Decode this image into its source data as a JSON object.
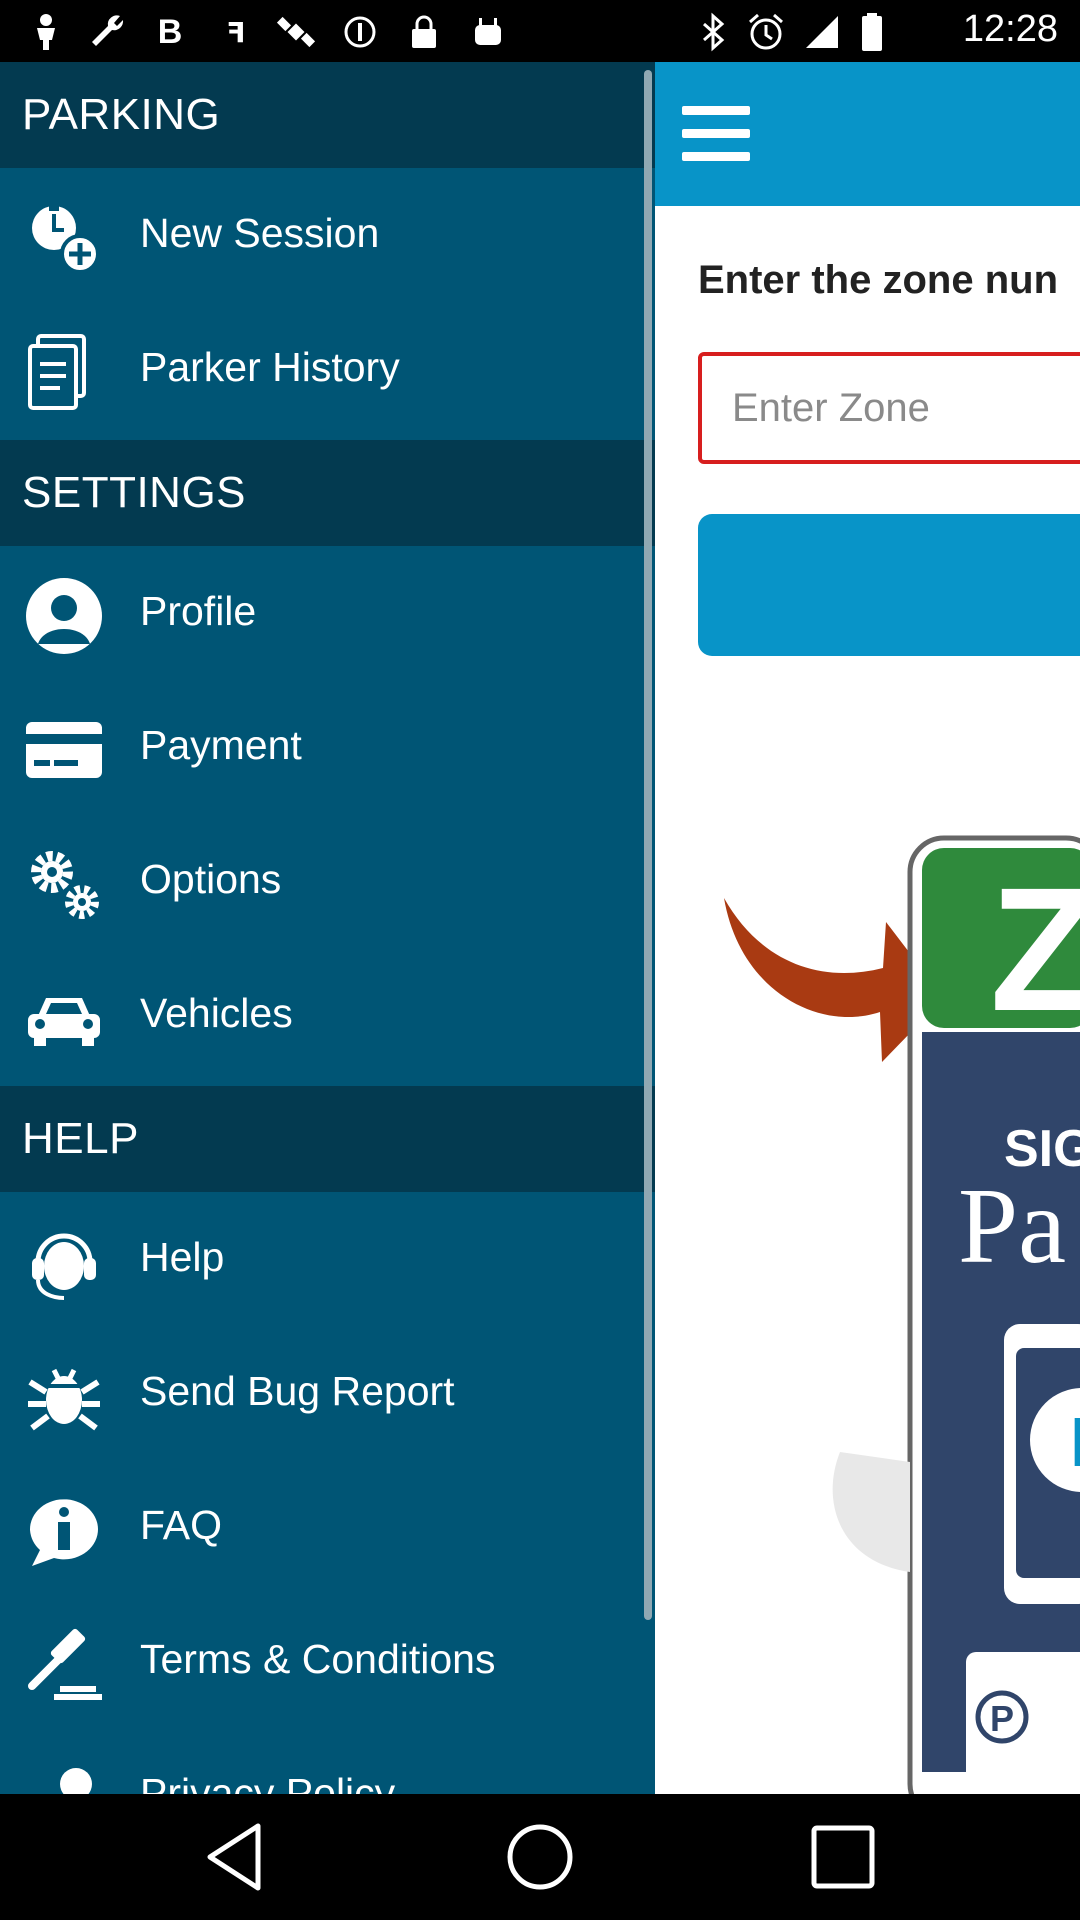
{
  "status_bar": {
    "time": "12:28",
    "left_icons": [
      "person-icon",
      "wrench-icon",
      "bold-b-icon",
      "s-arrow-icon",
      "fake-gps-icon",
      "alert-circle-icon",
      "lock-icon",
      "android-icon"
    ],
    "right_icons": [
      "bluetooth-icon",
      "alarm-icon",
      "signal-icon",
      "battery-icon"
    ]
  },
  "drawer": {
    "sections": [
      {
        "title": "PARKING",
        "items": [
          {
            "label": "New Session",
            "icon": "new-session-icon"
          },
          {
            "label": "Parker History",
            "icon": "history-icon"
          }
        ]
      },
      {
        "title": "SETTINGS",
        "items": [
          {
            "label": "Profile",
            "icon": "profile-icon"
          },
          {
            "label": "Payment",
            "icon": "credit-card-icon"
          },
          {
            "label": "Options",
            "icon": "gears-icon"
          },
          {
            "label": "Vehicles",
            "icon": "car-icon"
          }
        ]
      },
      {
        "title": "HELP",
        "items": [
          {
            "label": "Help",
            "icon": "headset-icon"
          },
          {
            "label": "Send Bug Report",
            "icon": "bug-icon"
          },
          {
            "label": "FAQ",
            "icon": "info-bubble-icon"
          },
          {
            "label": "Terms & Conditions",
            "icon": "gavel-icon"
          },
          {
            "label": "Privacy Policy",
            "icon": "privacy-icon"
          }
        ]
      }
    ]
  },
  "main": {
    "prompt": "Enter the zone nun",
    "zone_placeholder": "Enter Zone",
    "sign_text": {
      "top": "ZO",
      "middle": "SIG",
      "brand": "Pa",
      "p_badge": "P"
    }
  },
  "colors": {
    "drawer_bg": "#005575",
    "section_bg": "#033a50",
    "accent": "#0894c8",
    "input_border": "#d71e1e"
  }
}
